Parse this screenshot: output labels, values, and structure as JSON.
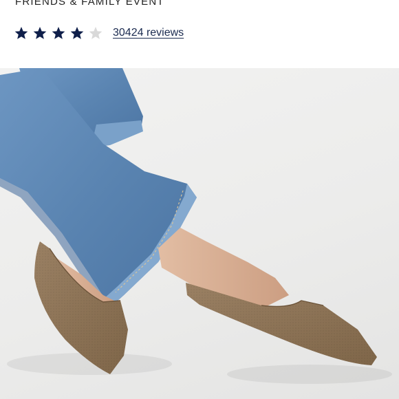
{
  "promo": {
    "text": "FRIENDS & FAMILY EVENT"
  },
  "rating": {
    "value": 4,
    "max": 5,
    "filled_color": "#0f1f4a",
    "empty_color": "#d9d9d9",
    "reviews_label": "30424 reviews"
  },
  "product_image": {
    "subject": "tan knit pointed-toe flats worn with light-wash jeans",
    "colors": {
      "denim": "#5f89b7",
      "shoe": "#8f7659",
      "skin": "#d8ae93",
      "background": "#ececeb"
    }
  }
}
